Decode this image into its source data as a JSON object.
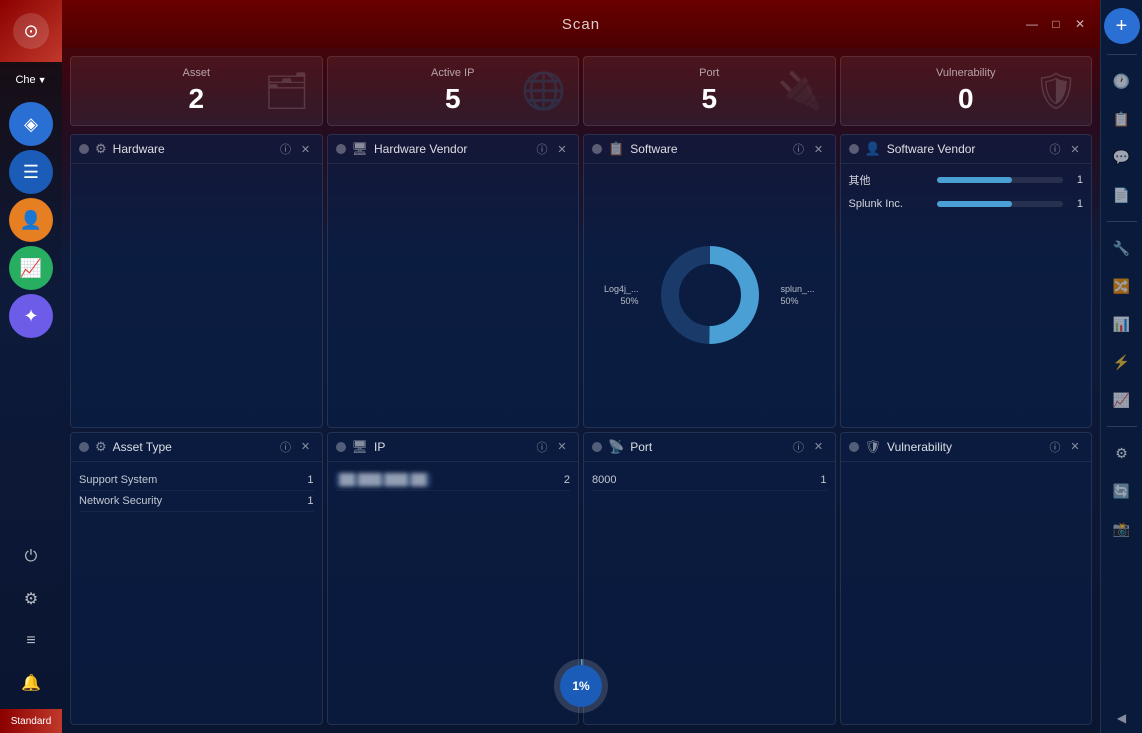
{
  "app": {
    "title": "Scan",
    "user": "Che",
    "standard_badge": "Standard"
  },
  "window_controls": {
    "minimize": "—",
    "maximize": "□",
    "close": "✕"
  },
  "stats": [
    {
      "label": "Asset",
      "value": "2",
      "icon": "🗂"
    },
    {
      "label": "Active IP",
      "value": "5",
      "icon": "🌐"
    },
    {
      "label": "Port",
      "value": "5",
      "icon": "🔌"
    },
    {
      "label": "Vulnerability",
      "value": "0",
      "icon": "🛡"
    }
  ],
  "panels_top": [
    {
      "id": "hardware",
      "title": "Hardware",
      "icon": "⚙",
      "content_type": "empty"
    },
    {
      "id": "hardware-vendor",
      "title": "Hardware Vendor",
      "icon": "🖥",
      "content_type": "empty"
    },
    {
      "id": "software",
      "title": "Software",
      "icon": "📋",
      "content_type": "donut",
      "donut_data": [
        {
          "label": "Log4j_...\n50%",
          "percent": 50,
          "color": "#4a9fd4"
        },
        {
          "label": "splun_...\n50%",
          "percent": 50,
          "color": "#1a3a6a"
        }
      ]
    },
    {
      "id": "software-vendor",
      "title": "Software Vendor",
      "icon": "👤",
      "content_type": "bar_list",
      "items": [
        {
          "name": "其他",
          "count": 1,
          "bar_pct": 60
        },
        {
          "name": "Splunk Inc.",
          "count": 1,
          "bar_pct": 60
        }
      ]
    }
  ],
  "panels_bottom": [
    {
      "id": "asset-type",
      "title": "Asset Type",
      "icon": "⚙",
      "content_type": "table",
      "items": [
        {
          "name": "Support System",
          "value": "1"
        },
        {
          "name": "Network Security",
          "value": "1"
        }
      ]
    },
    {
      "id": "ip",
      "title": "IP",
      "icon": "🖥",
      "content_type": "table_blurred",
      "items": [
        {
          "name": "██.███.███.██",
          "value": "2"
        }
      ]
    },
    {
      "id": "port",
      "title": "Port",
      "icon": "📡",
      "content_type": "table",
      "items": [
        {
          "name": "8000",
          "value": "1"
        }
      ]
    },
    {
      "id": "vulnerability",
      "title": "Vulnerability",
      "icon": "🛡",
      "content_type": "empty"
    }
  ],
  "progress": {
    "value": "1%",
    "percent": 1
  },
  "sidebar_nav": [
    {
      "id": "scan",
      "icon": "▦",
      "active": true,
      "color": "active-blue"
    },
    {
      "id": "list",
      "icon": "☰",
      "active": false,
      "color": "active-blue2"
    },
    {
      "id": "person",
      "icon": "👤",
      "active": false,
      "color": "active-orange"
    },
    {
      "id": "chart",
      "icon": "📈",
      "active": false,
      "color": "active-green"
    },
    {
      "id": "puzzle",
      "icon": "🧩",
      "active": false,
      "color": "active-purple"
    }
  ],
  "right_sidebar_icons": [
    "➕",
    "🕐",
    "📋",
    "💬",
    "📄",
    "🔧",
    "🔀",
    "📊",
    "🔀",
    "📊",
    "⚙",
    "🔄",
    "📸",
    "◀"
  ]
}
